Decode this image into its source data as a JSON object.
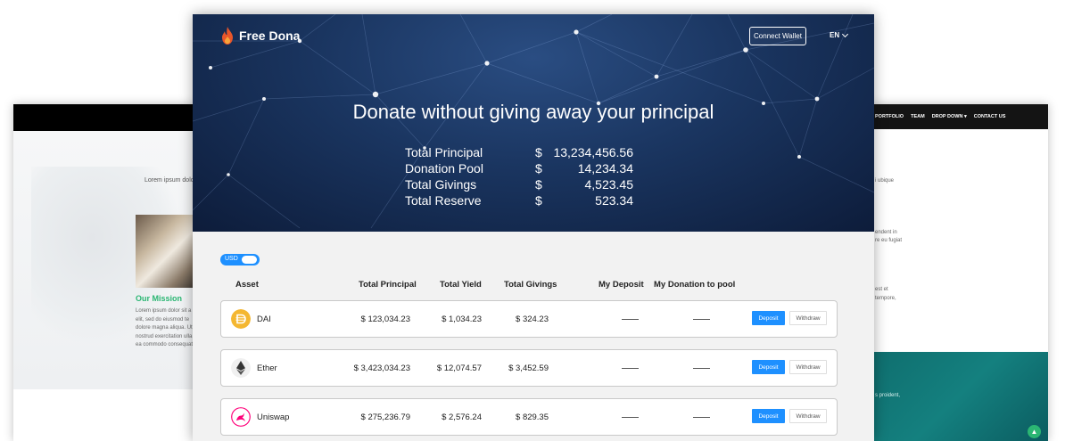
{
  "bg_left": {
    "lorem_top": "Lorem ipsum dolo",
    "mission_title": "Our Mission",
    "mission_text": "Lorem ipsum dolor sit a elit, sed do eiusmod te dolore magna aliqua. Ut nostrud exercitation ulla ea commodo consequat"
  },
  "bg_right": {
    "nav": [
      "PORTFOLIO",
      "TEAM",
      "DROP DOWN ▾",
      "CONTACT US"
    ],
    "text1": "i ubique",
    "text2": "endent in",
    "text3": "re eu fugiat",
    "text4": "est et",
    "text5": "tempore,",
    "teal_text": "s proident,"
  },
  "header": {
    "brand": "Free Dona",
    "connect_label": "Connect Wallet",
    "language": "EN"
  },
  "hero": {
    "headline": "Donate without giving away your principal",
    "stats": [
      {
        "label": "Total Principal",
        "currency": "$",
        "value": "13,234,456.56"
      },
      {
        "label": "Donation Pool",
        "currency": "$",
        "value": "14,234.34"
      },
      {
        "label": "Total Givings",
        "currency": "$",
        "value": "4,523.45"
      },
      {
        "label": "Total Reserve",
        "currency": "$",
        "value": "523.34"
      }
    ]
  },
  "currency_toggle": {
    "label": "USD",
    "on": true
  },
  "table": {
    "columns": [
      "Asset",
      "Total Principal",
      "Total Yield",
      "Total Givings",
      "My Deposit",
      "My Donation to pool"
    ],
    "deposit_label": "Deposit",
    "withdraw_label": "Withdraw",
    "rows": [
      {
        "asset": "DAI",
        "icon": "dai-icon",
        "total_principal": "$ 123,034.23",
        "total_yield": "$ 1,034.23",
        "total_givings": "$ 324.23",
        "my_deposit": "—",
        "my_donation": "—"
      },
      {
        "asset": "Ether",
        "icon": "ether-icon",
        "total_principal": "$ 3,423,034.23",
        "total_yield": "$ 12,074.57",
        "total_givings": "$ 3,452.59",
        "my_deposit": "—",
        "my_donation": "—"
      },
      {
        "asset": "Uniswap",
        "icon": "uniswap-icon",
        "total_principal": "$ 275,236.79",
        "total_yield": "$ 2,576.24",
        "total_givings": "$ 829.35",
        "my_deposit": "—",
        "my_donation": "—"
      }
    ]
  },
  "colors": {
    "accent": "#1e90ff",
    "hero_dark": "#0d1c3a",
    "mission_green": "#2bb673",
    "teal": "#14807f"
  }
}
